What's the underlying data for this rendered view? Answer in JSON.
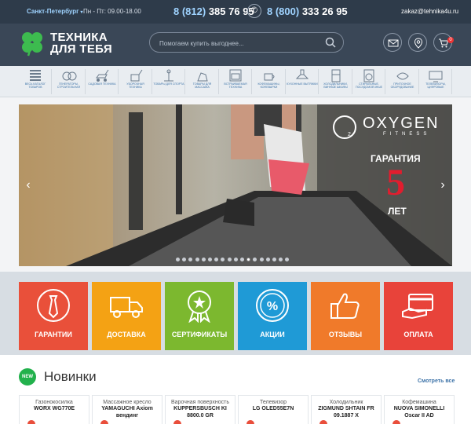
{
  "topbar": {
    "city": "Санкт-Петербург",
    "hours": "Пн - Пт: 09.00-18.00",
    "phone1_code": "8 (812)",
    "phone1_num": "385 76 95",
    "phone2_code": "8 (800)",
    "phone2_num": "333 26 95",
    "email": "zakaz@tehnika4u.ru"
  },
  "header": {
    "logo_line1": "ТЕХНИКА",
    "logo_line2": "ДЛЯ ТЕБЯ",
    "search_placeholder": "Помогаем купить выгоднее...",
    "cart_count": "0",
    "icons": [
      "mail-icon",
      "location-icon",
      "cart-icon"
    ]
  },
  "categories": [
    {
      "label": "Весь каталог товаров",
      "icon": "catalog-icon"
    },
    {
      "label": "Генераторы, строительная",
      "icon": "generator-icon"
    },
    {
      "label": "Садовая техника",
      "icon": "lawnmower-icon"
    },
    {
      "label": "Уборочная техника",
      "icon": "cleaning-icon"
    },
    {
      "label": "Товары для спорта",
      "icon": "sport-icon"
    },
    {
      "label": "Товары для массажа",
      "icon": "massage-icon"
    },
    {
      "label": "Встраиваемая техника",
      "icon": "oven-icon"
    },
    {
      "label": "Кофемашины, кофеварки",
      "icon": "coffee-icon"
    },
    {
      "label": "Кухонные вытяжки",
      "icon": "hood-icon"
    },
    {
      "label": "Холодильники, винные шкафы",
      "icon": "fridge-icon"
    },
    {
      "label": "Стиральные, посудомоечные",
      "icon": "washer-icon"
    },
    {
      "label": "Приточное оборудование",
      "icon": "ventilation-icon"
    },
    {
      "label": "Телевизоры, цифровые",
      "icon": "tv-icon"
    }
  ],
  "slider": {
    "brand": "OXYGEN",
    "brand_sub": "FITNESS",
    "guarantee": "ГАРАНТИЯ",
    "years_num": "5",
    "years_label": "ЛЕТ",
    "dot_count": 18,
    "active_dot": 11
  },
  "tiles": [
    {
      "label": "ГАРАНТИИ",
      "color": "#e9503a",
      "icon": "tie-icon"
    },
    {
      "label": "ДОСТАВКА",
      "color": "#f4a214",
      "icon": "truck-icon"
    },
    {
      "label": "СЕРТИФИКАТЫ",
      "color": "#7cb82f",
      "icon": "certificate-icon"
    },
    {
      "label": "АКЦИИ",
      "color": "#1f9ad6",
      "icon": "percent-icon"
    },
    {
      "label": "ОТЗЫВЫ",
      "color": "#f07a2a",
      "icon": "thumbs-up-icon"
    },
    {
      "label": "ОПЛАТА",
      "color": "#e8433a",
      "icon": "payment-card-icon"
    }
  ],
  "section": {
    "badge": "NEW",
    "title": "Новинки",
    "see_all": "Смотреть все"
  },
  "products": [
    {
      "type": "Газонокосилка",
      "name1": "WORX WG770E",
      "name2": ""
    },
    {
      "type": "Массажное кресло",
      "name1": "YAMAGUCHI Axiom",
      "name2": "вендинг"
    },
    {
      "type": "Варочная поверхность",
      "name1": "KUPPERSBUSCH KI",
      "name2": "8800.0 GR"
    },
    {
      "type": "Телевизор",
      "name1": "LG OLED55E7N",
      "name2": ""
    },
    {
      "type": "Холодильник",
      "name1": "ZIGMUND SHTAIN FR",
      "name2": "09.1887 X"
    },
    {
      "type": "Кофемашина",
      "name1": "NUOVA SIMONELLI",
      "name2": "Oscar II AD"
    }
  ]
}
